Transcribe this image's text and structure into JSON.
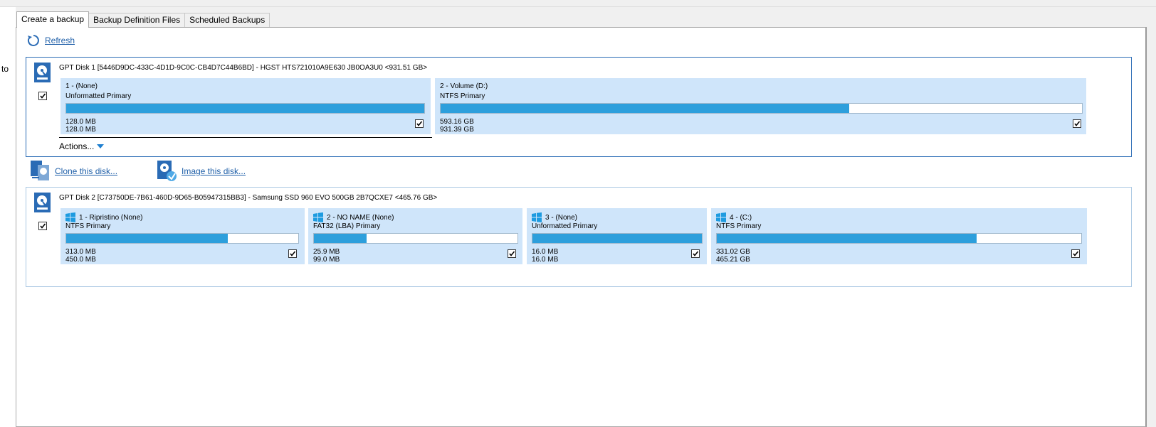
{
  "left_pane": {
    "label": "to"
  },
  "tabs": [
    {
      "label": "Create a backup",
      "active": true
    },
    {
      "label": "Backup Definition Files",
      "active": false
    },
    {
      "label": "Scheduled Backups",
      "active": false
    }
  ],
  "refresh": {
    "label": "Refresh",
    "icon": "refresh-icon"
  },
  "disk1": {
    "title": "GPT Disk 1 [5446D9DC-433C-4D1D-9C0C-CB4D7C44B6BD] - HGST HTS721010A9E630 JB0OA3U0  <931.51 GB>",
    "icon": "hard-disk-icon",
    "checked": true,
    "partitions": [
      {
        "name": "1 -  (None)",
        "type": "Unformatted Primary",
        "used": "128.0 MB",
        "total": "128.0 MB",
        "fill": 1.0,
        "checked": true
      },
      {
        "name": "2 - Volume (D:)",
        "type": "NTFS Primary",
        "used": "593.16 GB",
        "total": "931.39 GB",
        "fill": 0.637,
        "checked": true
      }
    ],
    "actions_label": "Actions..."
  },
  "disk_actions": {
    "clone_label": "Clone this disk...",
    "image_label": "Image this disk..."
  },
  "disk2": {
    "title": "GPT Disk 2 [C73750DE-7B61-460D-9D65-B05947315BB3] - Samsung SSD 960 EVO 500GB 2B7QCXE7  <465.76 GB>",
    "icon": "hard-disk-icon",
    "checked": true,
    "partitions": [
      {
        "name": "1 - Ripristino (None)",
        "type": "NTFS Primary",
        "used": "313.0 MB",
        "total": "450.0 MB",
        "fill": 0.695,
        "checked": true,
        "windows": true
      },
      {
        "name": "2 - NO NAME (None)",
        "type": "FAT32 (LBA) Primary",
        "used": "25.9 MB",
        "total": "99.0 MB",
        "fill": 0.26,
        "checked": true,
        "windows": true
      },
      {
        "name": "3 -  (None)",
        "type": "Unformatted Primary",
        "used": "16.0 MB",
        "total": "16.0 MB",
        "fill": 1.0,
        "checked": true,
        "windows": true
      },
      {
        "name": "4 -  (C:)",
        "type": "NTFS Primary",
        "used": "331.02 GB",
        "total": "465.21 GB",
        "fill": 0.712,
        "checked": true,
        "windows": true
      }
    ]
  },
  "colors": {
    "accent": "#2d9fdc",
    "partition_bg": "#cfe5fa",
    "link": "#1f5fa8",
    "disk_border": "#2a6bb5"
  }
}
